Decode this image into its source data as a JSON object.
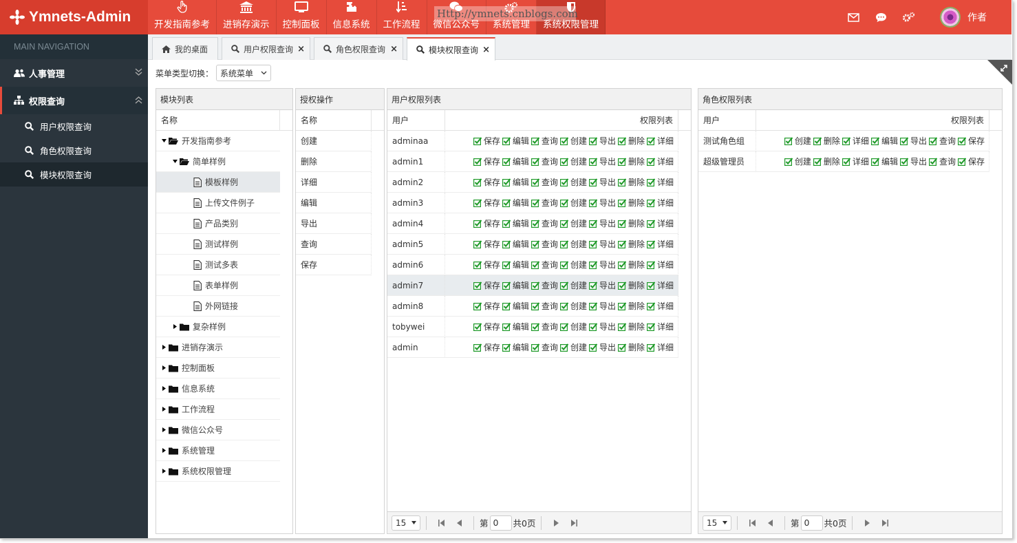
{
  "app": {
    "title": "Ymnets-Admin",
    "watermark": "Http://ymnets.cnblogs.com",
    "user": "作者"
  },
  "topnav": [
    {
      "label": "开发指南参考",
      "icon": "hand-pointer-icon"
    },
    {
      "label": "进销存演示",
      "icon": "bank-icon"
    },
    {
      "label": "控制面板",
      "icon": "monitor-icon"
    },
    {
      "label": "信息系统",
      "icon": "puzzle-icon"
    },
    {
      "label": "工作流程",
      "icon": "sort-icon"
    },
    {
      "label": "微信公众号",
      "icon": "wechat-icon"
    },
    {
      "label": "系统管理",
      "icon": "cogs-icon"
    },
    {
      "label": "系统权限管理",
      "icon": "shield-icon"
    }
  ],
  "sidebar": {
    "title": "MAIN NAVIGATION",
    "groups": [
      {
        "label": "人事管理"
      },
      {
        "label": "权限查询"
      }
    ],
    "items": [
      {
        "label": "用户权限查询"
      },
      {
        "label": "角色权限查询"
      },
      {
        "label": "模块权限查询"
      }
    ]
  },
  "tabs": [
    {
      "label": "我的桌面"
    },
    {
      "label": "用户权限查询"
    },
    {
      "label": "角色权限查询"
    },
    {
      "label": "模块权限查询"
    }
  ],
  "switcher": {
    "label": "菜单类型切换：",
    "value": "系统菜单"
  },
  "module_panel": {
    "title": "模块列表",
    "column": "名称",
    "tree": [
      {
        "label": "开发指南参考",
        "level": 0,
        "expanded": true
      },
      {
        "label": "简单样例",
        "level": 1,
        "expanded": true
      },
      {
        "label": "模板样例",
        "level": 2,
        "leaf": true
      },
      {
        "label": "上传文件例子",
        "level": 2,
        "leaf": true
      },
      {
        "label": "产品类别",
        "level": 2,
        "leaf": true
      },
      {
        "label": "测试样例",
        "level": 2,
        "leaf": true
      },
      {
        "label": "测试多表",
        "level": 2,
        "leaf": true
      },
      {
        "label": "表单样例",
        "level": 2,
        "leaf": true
      },
      {
        "label": "外网链接",
        "level": 2,
        "leaf": true
      },
      {
        "label": "复杂样例",
        "level": 1,
        "expanded": false
      },
      {
        "label": "进销存演示",
        "level": 0,
        "expanded": false
      },
      {
        "label": "控制面板",
        "level": 0,
        "expanded": false
      },
      {
        "label": "信息系统",
        "level": 0,
        "expanded": false
      },
      {
        "label": "工作流程",
        "level": 0,
        "expanded": false
      },
      {
        "label": "微信公众号",
        "level": 0,
        "expanded": false
      },
      {
        "label": "系统管理",
        "level": 0,
        "expanded": false
      },
      {
        "label": "系统权限管理",
        "level": 0,
        "expanded": false
      }
    ]
  },
  "auth_panel": {
    "title": "授权操作",
    "column": "名称",
    "rows": [
      "创建",
      "删除",
      "详细",
      "编辑",
      "导出",
      "查询",
      "保存"
    ]
  },
  "user_panel": {
    "title": "用户权限列表",
    "columns": [
      "用户",
      "权限列表"
    ],
    "perms": [
      "保存",
      "编辑",
      "查询",
      "创建",
      "导出",
      "删除",
      "详细"
    ],
    "rows": [
      "adminaa",
      "admin1",
      "admin2",
      "admin3",
      "admin4",
      "admin5",
      "admin6",
      "admin7",
      "admin8",
      "tobywei",
      "admin"
    ],
    "pager": {
      "size": "15",
      "page_prefix": "第",
      "page": "0",
      "total": "共0页"
    }
  },
  "role_panel": {
    "title": "角色权限列表",
    "columns": [
      "用户",
      "权限列表"
    ],
    "perms": [
      "创建",
      "删除",
      "详细",
      "编辑",
      "导出",
      "查询",
      "保存"
    ],
    "rows": [
      "测试角色组",
      "超级管理员"
    ],
    "pager": {
      "size": "15",
      "page_prefix": "第",
      "page": "0",
      "total": "共0页"
    }
  },
  "colors": {
    "accent": "#e64b3b",
    "sidebar": "#2b353d",
    "check": "#1f9a29"
  }
}
